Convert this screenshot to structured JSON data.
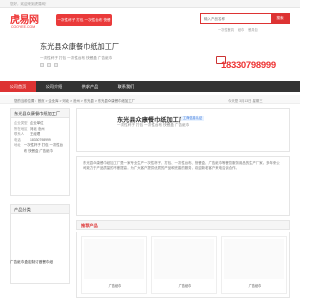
{
  "topbar": {
    "text": "您好，欢迎来到虎易网！"
  },
  "logo": {
    "main": "虎易网",
    "sub": "COOYEE.COM"
  },
  "slogan": "一次性杯子 打包 一次性台布 快餐盒 广告纸巾",
  "search": {
    "placeholder": "输入产品名称",
    "button": "搜索"
  },
  "hotwords": [
    "一次性餐具",
    "纸巾",
    "餐具包"
  ],
  "company": {
    "name": "东光县众康餐巾纸加工厂",
    "desc": "一次性杯子 打包 一次性台布 快餐盒 广告纸巾",
    "phone": "18330798999"
  },
  "nav": [
    "公司首页",
    "公司介绍",
    "供求产品",
    "联系我们"
  ],
  "breadcrumb": "您的当前位置：首页 > 企业库 > 河北 > 沧州 > 东光县 > 东光县众康餐巾纸加工厂",
  "date_text": "今天是 3月13日  星期三",
  "sidebar": {
    "contact_title": "东光县众康餐巾纸加工厂",
    "rows": [
      {
        "k": "企业类型",
        "v": "企业单位"
      },
      {
        "k": "所在地区",
        "v": "河北 沧州"
      },
      {
        "k": "联系人",
        "v": "王经理"
      },
      {
        "k": "电话",
        "v": "18330798999"
      },
      {
        "k": "地址",
        "v": "一次性杯子 打包 一次性台布 快餐盒 广告纸巾"
      }
    ],
    "products_title": "产品分类"
  },
  "main": {
    "title": "东光县众康餐巾纸加工厂",
    "tag": "工商信息认证",
    "sub": "一次性杯子 打包 一次性台布 快餐盒 广告纸巾",
    "desc": "东光县众康餐巾纸加工厂是一家专业生产一次性杯子、打包、一次性台布、快餐盒、广告纸巾等餐饮服务用品的生产厂家。多年来公司致力于产品质量的不断提高，为广大客户提供优质的产品和完善的服务，欢迎新老客户来电洽谈合作。",
    "products_header": "推荐产品",
    "products": [
      "广告纸巾",
      "广告纸巾",
      "广告纸巾"
    ]
  },
  "bottom_note": "广告纸巾盒定制订做餐巾纸"
}
